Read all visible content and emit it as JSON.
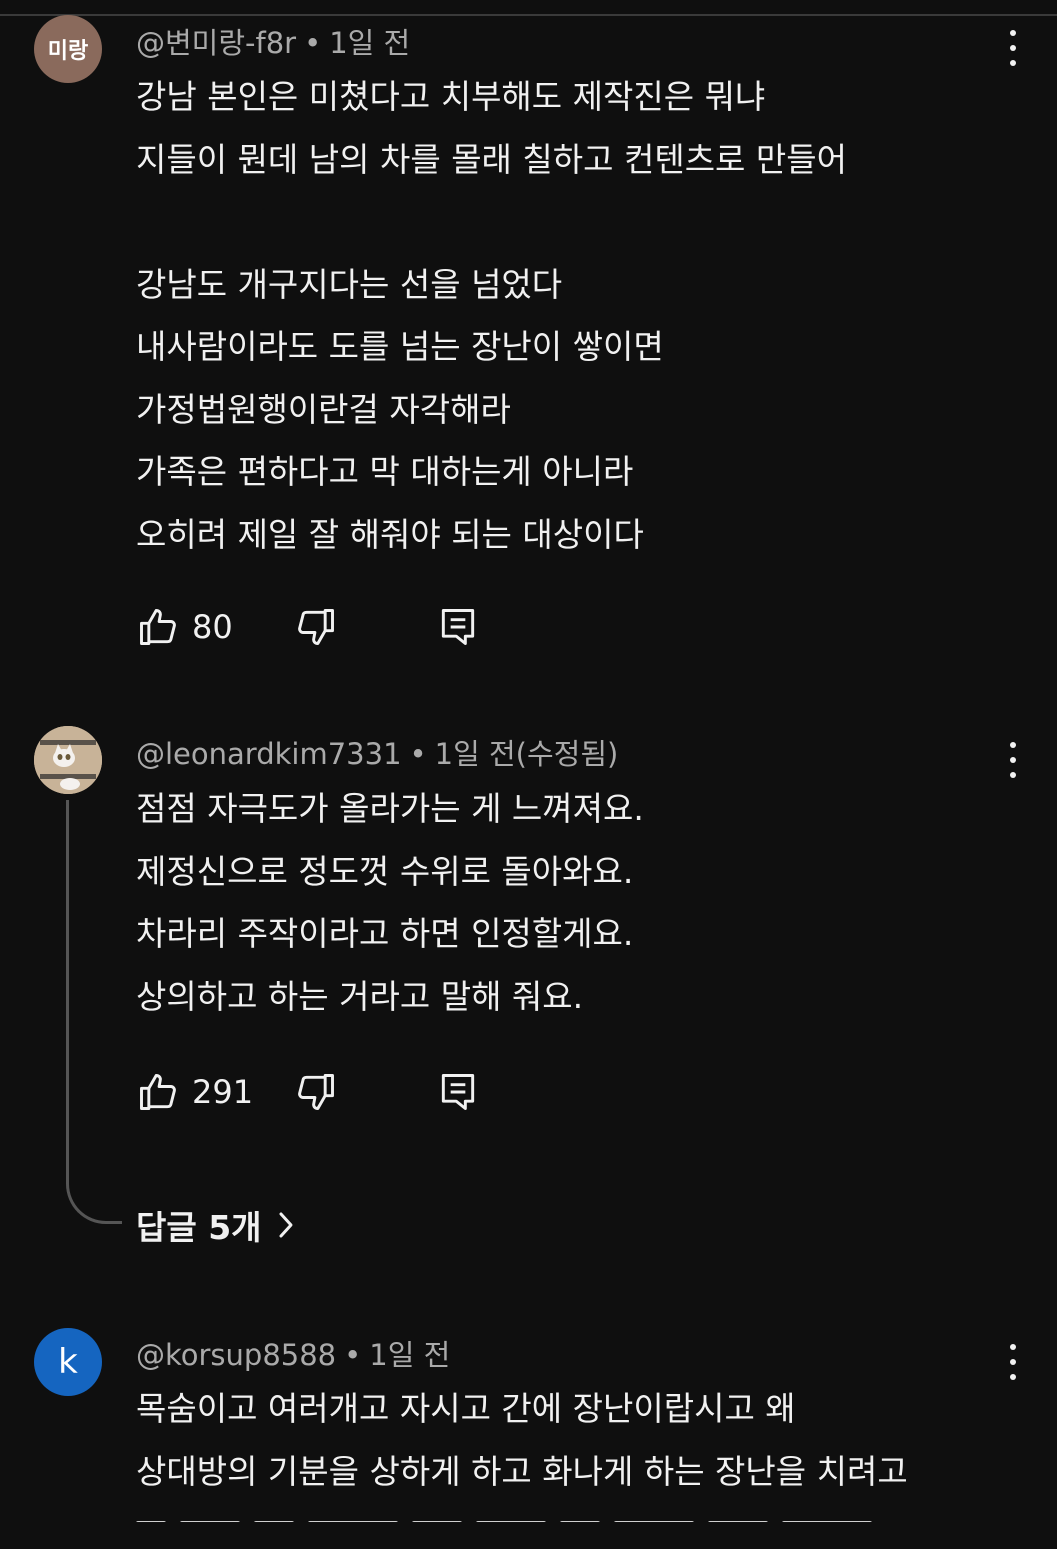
{
  "comments": [
    {
      "avatar_text": "미랑",
      "author": "@변미랑-f8r",
      "time": "1일 전",
      "lines": [
        "강남 본인은 미쳤다고 치부해도 제작진은 뭐냐",
        "지들이 뭔데 남의 차를 몰래 칠하고 컨텐츠로 만들어",
        "",
        "강남도 개구지다는 선을 넘었다",
        "내사람이라도 도를 넘는 장난이 쌓이면",
        "가정법원행이란걸 자각해라",
        "가족은 편하다고 막 대하는게 아니라",
        "오히려 제일 잘 해줘야 되는 대상이다"
      ],
      "likes": "80"
    },
    {
      "avatar_icon": "cat-photo-avatar",
      "author": "@leonardkim7331",
      "time": "1일 전(수정됨)",
      "lines": [
        "점점 자극도가 올라가는 게 느껴져요.",
        "제정신으로 정도껏 수위로 돌아와요.",
        "차라리 주작이라고 하면 인정할게요.",
        "상의하고 하는 거라고 말해 줘요."
      ],
      "likes": "291",
      "replies_label": "답글 5개"
    },
    {
      "avatar_text": "k",
      "author": "@korsup8588",
      "time": "1일 전",
      "lines": [
        "목숨이고 여러개고 자시고 간에 장난이랍시고 왜",
        "상대방의 기분을 상하게 하고 화나게 하는 장난을 치려고"
      ]
    }
  ],
  "separator": "•",
  "colors": {
    "background": "#0f0f0f",
    "text": "#f1f1f1",
    "meta": "#aaaaaa",
    "avatar_k": "#1565c0"
  }
}
